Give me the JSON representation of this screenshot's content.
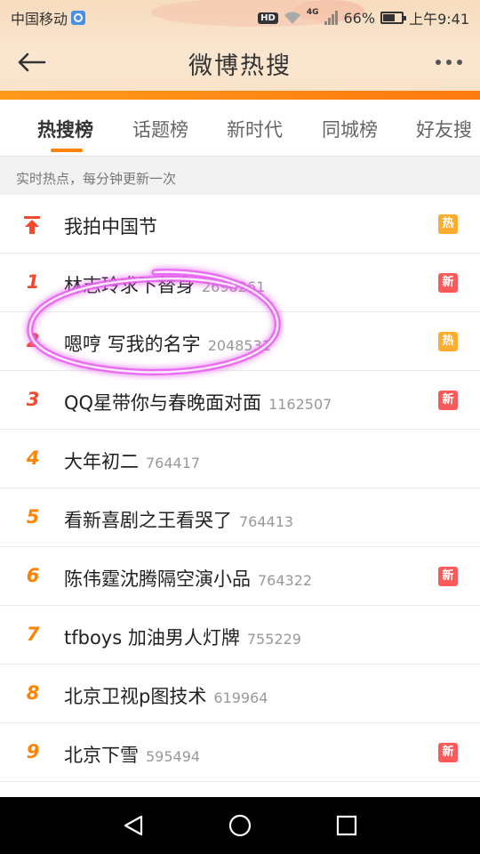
{
  "status_bar": {
    "carrier": "中国移动",
    "hd": "HD",
    "network": "4G",
    "battery": "66%",
    "time": "上午9:41"
  },
  "header": {
    "title": "微博热搜",
    "back_icon": "arrow-left-icon",
    "more_icon": "more-dots-icon"
  },
  "tabs": [
    {
      "label": "热搜榜",
      "active": true
    },
    {
      "label": "话题榜",
      "active": false
    },
    {
      "label": "新时代",
      "active": false
    },
    {
      "label": "同城榜",
      "active": false
    },
    {
      "label": "好友搜",
      "active": false
    }
  ],
  "subheader": "实时热点，每分钟更新一次",
  "list": [
    {
      "rank": "",
      "pinned": true,
      "title": "我拍中国节",
      "count": "",
      "badge": "热",
      "badge_type": "hot"
    },
    {
      "rank": "1",
      "pinned": false,
      "title": "林志玲求下替身",
      "count": "2698261",
      "badge": "新",
      "badge_type": "new"
    },
    {
      "rank": "2",
      "pinned": false,
      "title": "嗯哼 写我的名字",
      "count": "2048531",
      "badge": "热",
      "badge_type": "hot"
    },
    {
      "rank": "3",
      "pinned": false,
      "title": "QQ星带你与春晚面对面",
      "count": "1162507",
      "badge": "新",
      "badge_type": "new"
    },
    {
      "rank": "4",
      "pinned": false,
      "title": "大年初二",
      "count": "764417",
      "badge": "",
      "badge_type": ""
    },
    {
      "rank": "5",
      "pinned": false,
      "title": "看新喜剧之王看哭了",
      "count": "764413",
      "badge": "",
      "badge_type": ""
    },
    {
      "rank": "6",
      "pinned": false,
      "title": "陈伟霆沈腾隔空演小品",
      "count": "764322",
      "badge": "新",
      "badge_type": "new"
    },
    {
      "rank": "7",
      "pinned": false,
      "title": "tfboys 加油男人灯牌",
      "count": "755229",
      "badge": "",
      "badge_type": ""
    },
    {
      "rank": "8",
      "pinned": false,
      "title": "北京卫视p图技术",
      "count": "619964",
      "badge": "",
      "badge_type": ""
    },
    {
      "rank": "9",
      "pinned": false,
      "title": "北京下雪",
      "count": "595494",
      "badge": "新",
      "badge_type": "new"
    }
  ],
  "colors": {
    "accent": "#ff8200",
    "rank_top": "#f5492d",
    "badge_hot": "#ffab2d",
    "badge_new": "#fa5a5a",
    "annotation": "#e040fb"
  },
  "nav_bar": {
    "back_icon": "triangle-back-icon",
    "home_icon": "circle-home-icon",
    "recents_icon": "square-recents-icon"
  }
}
